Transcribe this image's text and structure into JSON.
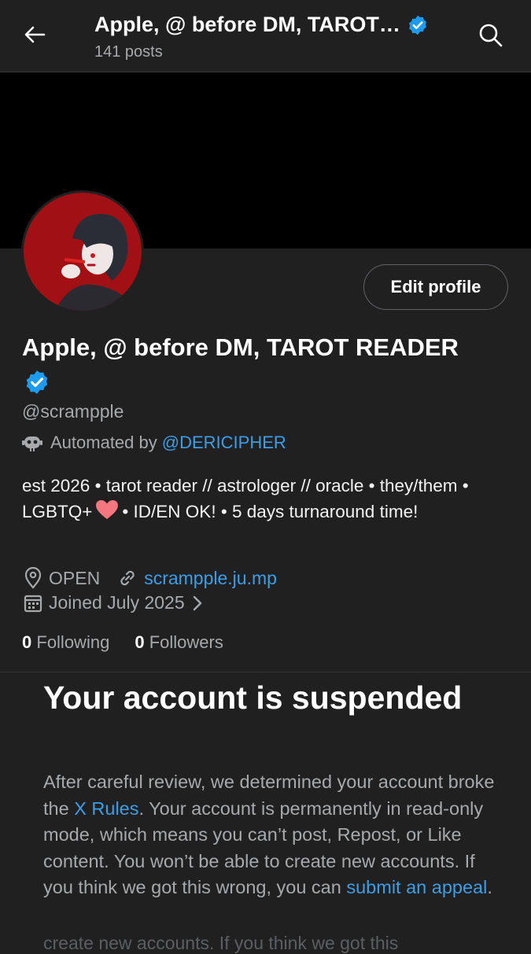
{
  "header": {
    "title": "Apple, @ before DM, TAROT…",
    "posts_count": "141 posts"
  },
  "profile": {
    "display_name": "Apple, @ before DM, TAROT READER",
    "handle": "@scrampple",
    "automated_prefix": "Automated by",
    "automated_by": "@DERICIPHER",
    "edit_profile_label": "Edit profile",
    "bio_part1": "est 2026 • tarot reader // astrologer // oracle • they/them • LGBTQ+",
    "bio_part2": "• ID/EN OK! • 5 days turnaround time!",
    "location": "OPEN",
    "website": "scrampple.ju.mp",
    "joined": "Joined July 2025",
    "following_count": "0",
    "following_label": "Following",
    "followers_count": "0",
    "followers_label": "Followers"
  },
  "suspension": {
    "title": "Your account is suspended",
    "body_part1": "After careful review, we determined your account broke the",
    "rules_link": "X Rules",
    "body_part2": ". Your account is permanently in read-only mode, which means you can’t post, Repost, or Like content. You won’t be able to create new accounts. If you think we got this wrong, you can",
    "appeal_link": "submit an appeal",
    "body_part3": ".",
    "faded_overflow": "create new accounts. If you think we got this"
  },
  "icons": {
    "back": "arrow-left-icon",
    "search": "search-icon",
    "verified": "verified-badge-icon",
    "automated": "robot-icon",
    "location": "location-pin-icon",
    "website": "link-icon",
    "calendar": "calendar-icon",
    "chevron": "chevron-right-icon",
    "heart": "heart-icon"
  },
  "colors": {
    "background": "#202021",
    "banner": "#000000",
    "accent_link": "#3b9ee6",
    "verified": "#1d9bf0",
    "muted_text": "#a7a9ab"
  }
}
